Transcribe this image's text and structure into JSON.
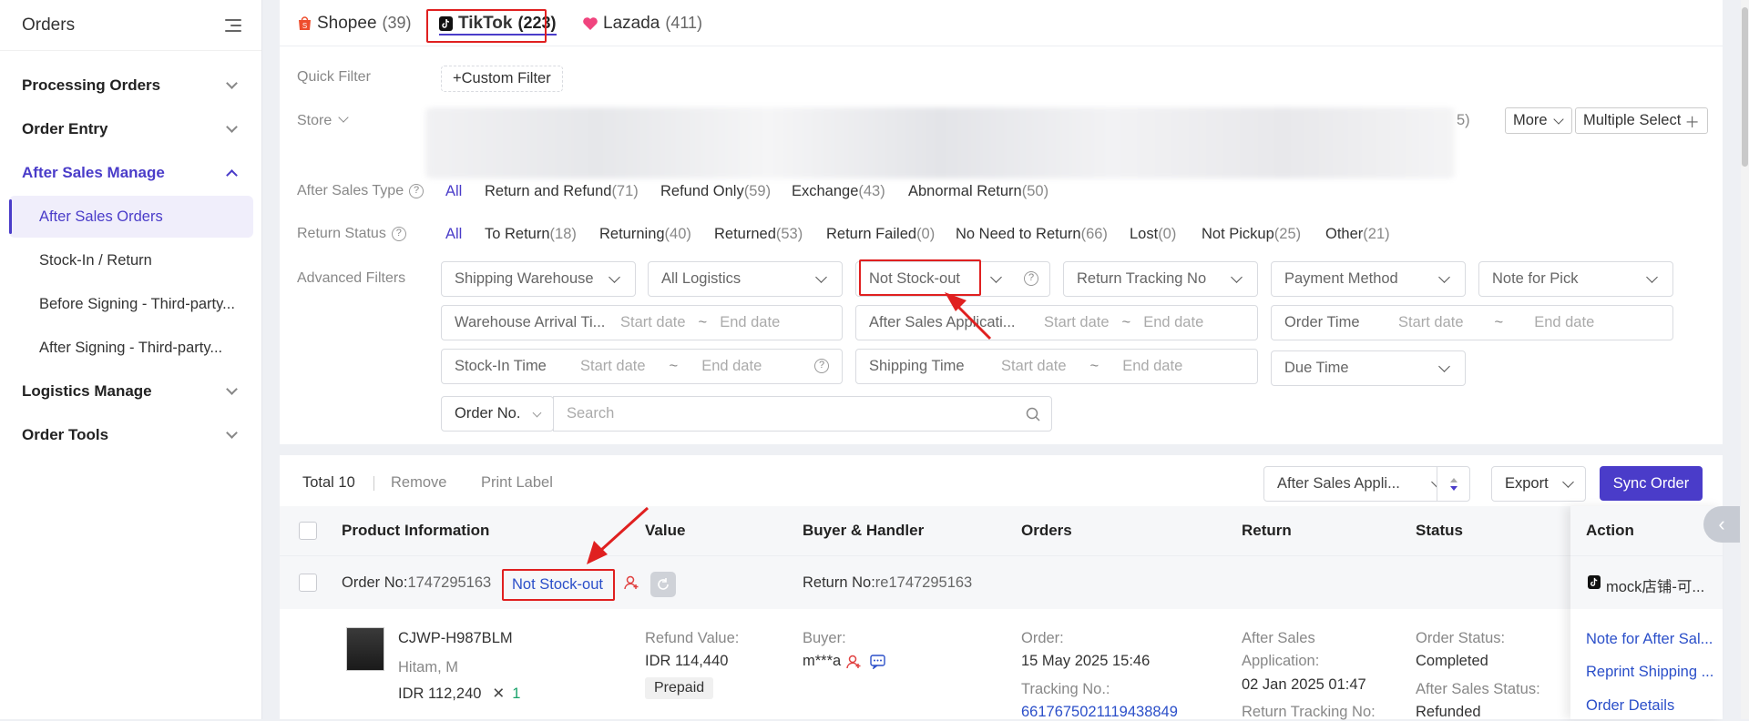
{
  "sidebar": {
    "title": "Orders",
    "items": [
      {
        "label": "Processing Orders"
      },
      {
        "label": "Order Entry"
      },
      {
        "label": "After Sales Manage"
      },
      {
        "label": "Logistics Manage"
      },
      {
        "label": "Order Tools"
      }
    ],
    "subitems": [
      {
        "label": "After Sales Orders"
      },
      {
        "label": "Stock-In / Return"
      },
      {
        "label": "Before Signing - Third-party..."
      },
      {
        "label": "After Signing - Third-party..."
      }
    ]
  },
  "tabs": [
    {
      "name": "Shopee",
      "count": "(39)"
    },
    {
      "name": "TikTok",
      "count": "(223)"
    },
    {
      "name": "Lazada",
      "count": "(411)"
    }
  ],
  "filters": {
    "quick_label": "Quick Filter",
    "custom_filter": "+Custom Filter",
    "store_label": "Store",
    "store_count_tail": "5)",
    "more": "More",
    "multiple_select": "Multiple Select",
    "after_sales_type_label": "After Sales Type",
    "after_sales_types": [
      {
        "label": "All",
        "n": ""
      },
      {
        "label": "Return and Refund",
        "n": "(71)"
      },
      {
        "label": "Refund Only",
        "n": "(59)"
      },
      {
        "label": "Exchange",
        "n": "(43)"
      },
      {
        "label": "Abnormal Return",
        "n": "(50)"
      }
    ],
    "return_status_label": "Return Status",
    "return_statuses": [
      {
        "label": "All",
        "n": ""
      },
      {
        "label": "To Return",
        "n": "(18)"
      },
      {
        "label": "Returning",
        "n": "(40)"
      },
      {
        "label": "Returned",
        "n": "(53)"
      },
      {
        "label": "Return Failed",
        "n": "(0)"
      },
      {
        "label": "No Need to Return",
        "n": "(66)"
      },
      {
        "label": "Lost",
        "n": "(0)"
      },
      {
        "label": "Not Pickup",
        "n": "(25)"
      },
      {
        "label": "Other",
        "n": "(21)"
      }
    ],
    "advanced_label": "Advanced Filters",
    "shipping_warehouse": "Shipping Warehouse",
    "all_logistics": "All Logistics",
    "not_stock_out": "Not Stock-out",
    "return_tracking": "Return Tracking No",
    "payment_method": "Payment Method",
    "note_for_pick": "Note for Pick",
    "warehouse_arrival": "Warehouse Arrival Ti...",
    "after_sales_application": "After Sales Applicati...",
    "order_time": "Order Time",
    "stock_in_time": "Stock-In Time",
    "shipping_time": "Shipping Time",
    "due_time": "Due Time",
    "start_date": "Start date",
    "end_date": "End date",
    "tilde": "~",
    "order_no_select": "Order No.",
    "search_placeholder": "Search"
  },
  "list": {
    "total": "Total 10",
    "remove": "Remove",
    "print_label": "Print Label",
    "sort_select": "After Sales Appli...",
    "export": "Export",
    "sync_order": "Sync Order",
    "headers": [
      "Product Information",
      "Value",
      "Buyer & Handler",
      "Orders",
      "Return",
      "Status",
      "Action"
    ],
    "order": {
      "order_no_label": "Order No:",
      "order_no": "1747295163",
      "badge": "Not Stock-out",
      "return_no_label": "Return No:",
      "return_no": "re1747295163",
      "store": "mock店铺-可...",
      "sku": "CJWP-H987BLM",
      "variant": "Hitam, M",
      "price": "IDR 112,240",
      "times": "✕",
      "qty": "1",
      "refund_label": "Refund Value:",
      "refund_value": "IDR 114,440",
      "prepaid": "Prepaid",
      "buyer_label": "Buyer:",
      "buyer": "m***a",
      "order_label": "Order:",
      "order_time": "15 May 2025 15:46",
      "tracking_label": "Tracking No.:",
      "tracking": "6617675021119438849",
      "as_app_label1": "After Sales",
      "as_app_label2": "Application:",
      "as_app_time": "02 Jan 2025 01:47",
      "return_tracking_label": "Return Tracking No:",
      "order_status_label": "Order Status:",
      "order_status": "Completed",
      "as_status_label": "After Sales Status:",
      "as_status": "Refunded",
      "actions": [
        "Note for After Sal...",
        "Reprint Shipping ...",
        "Order Details"
      ]
    }
  },
  "colors": {
    "accent": "#4a3cc9",
    "annotation": "#e02020",
    "link": "#2b4fc9"
  }
}
